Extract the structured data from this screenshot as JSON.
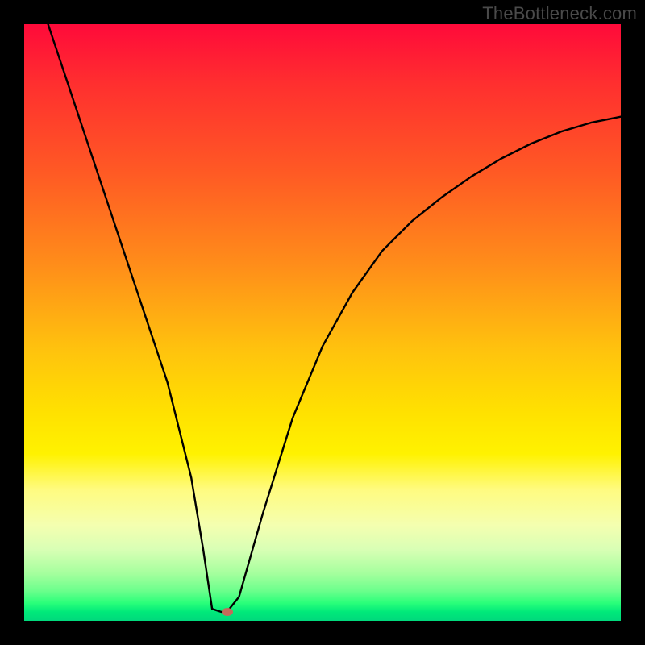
{
  "watermark": {
    "text": "TheBottleneck.com"
  },
  "chart_data": {
    "type": "line",
    "title": "",
    "xlabel": "",
    "ylabel": "",
    "xlim": [
      0,
      100
    ],
    "ylim": [
      0,
      100
    ],
    "grid": false,
    "legend": false,
    "background_gradient": {
      "orientation": "vertical",
      "stops": [
        {
          "pos": 0.0,
          "color": "#ff0a3a"
        },
        {
          "pos": 0.25,
          "color": "#ff5a24"
        },
        {
          "pos": 0.55,
          "color": "#ffc40d"
        },
        {
          "pos": 0.78,
          "color": "#fffb80"
        },
        {
          "pos": 0.92,
          "color": "#a6ff9e"
        },
        {
          "pos": 1.0,
          "color": "#00d97c"
        }
      ]
    },
    "series": [
      {
        "name": "curve",
        "color": "#000000",
        "x": [
          4,
          8,
          12,
          16,
          20,
          24,
          28,
          30,
          31.5,
          33,
          34,
          36,
          40,
          45,
          50,
          55,
          60,
          65,
          70,
          75,
          80,
          85,
          90,
          95,
          100
        ],
        "y": [
          100,
          88,
          76,
          64,
          52,
          40,
          24,
          12,
          2,
          1.5,
          1.5,
          4,
          18,
          34,
          46,
          55,
          62,
          67,
          71,
          74.5,
          77.5,
          80,
          82,
          83.5,
          84.5
        ]
      }
    ],
    "marker": {
      "x": 34,
      "y": 1.5,
      "color": "#c56a5a"
    }
  }
}
